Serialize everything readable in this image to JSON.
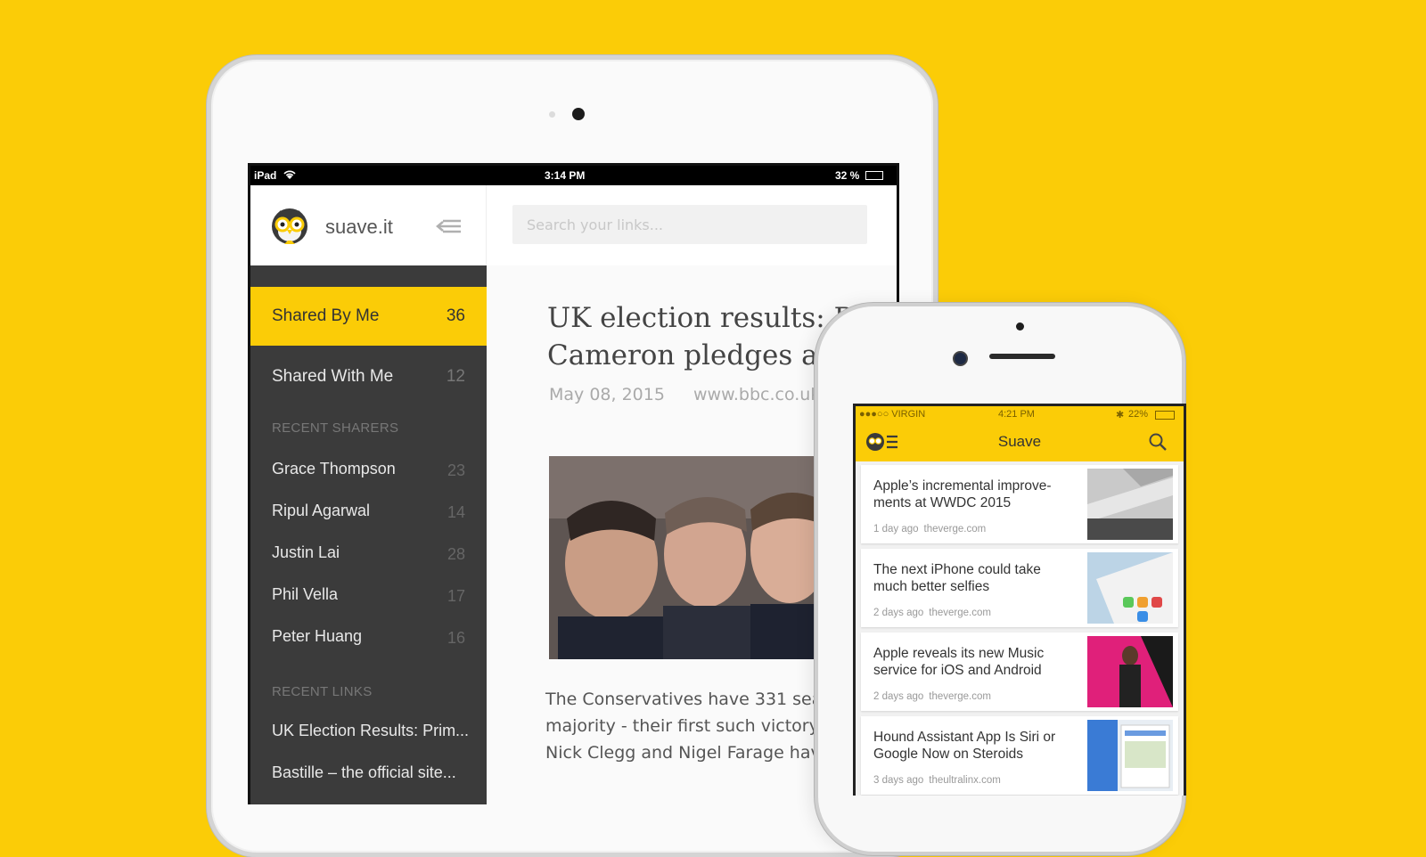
{
  "ipad": {
    "status": {
      "carrier": "iPad",
      "time": "3:14 PM",
      "battery": "32 %"
    },
    "brand": "suave.it",
    "search_placeholder": "Search your links...",
    "nav": [
      {
        "label": "Shared By Me",
        "count": "36",
        "active": true
      },
      {
        "label": "Shared With Me",
        "count": "12",
        "active": false
      }
    ],
    "recent_sharers_heading": "RECENT SHARERS",
    "sharers": [
      {
        "name": "Grace Thompson",
        "count": "23"
      },
      {
        "name": "Ripul Agarwal",
        "count": "14"
      },
      {
        "name": "Justin Lai",
        "count": "28"
      },
      {
        "name": "Phil Vella",
        "count": "17"
      },
      {
        "name": "Peter Huang",
        "count": "16"
      }
    ],
    "recent_links_heading": "RECENT LINKS",
    "links": [
      "UK Election Results: Prim...",
      "Bastille – the official site..."
    ],
    "article": {
      "title_line1": "UK election results: Prime Minister David",
      "title_line2": "Cameron pledges a ‘g",
      "date": "May 08, 2015",
      "source": "www.bbc.co.uk",
      "body_line1": "The Conservatives have 331 seats",
      "body_line2": "majority - their first such victory",
      "body_line3": "Nick Clegg and Nigel Farage have"
    }
  },
  "iphone": {
    "status": {
      "carrier": "●●●○○ VIRGIN",
      "time": "4:21 PM",
      "battery": "22%"
    },
    "title": "Suave",
    "cards": [
      {
        "title": "Apple’s incremental improve-ments at WWDC 2015",
        "time": "1 day ago",
        "source": "theverge.com"
      },
      {
        "title": "The next iPhone could take much better selfies",
        "time": "2 days ago",
        "source": "theverge.com"
      },
      {
        "title": "Apple reveals its new Music service for iOS and Android",
        "time": "2 days ago",
        "source": "theverge.com"
      },
      {
        "title": "Hound Assistant App Is Siri or Google Now on Steroids",
        "time": "3 days ago",
        "source": "theultralinx.com"
      }
    ]
  },
  "colors": {
    "brand_yellow": "#fbcc07",
    "sidebar": "#3b3b3b"
  }
}
